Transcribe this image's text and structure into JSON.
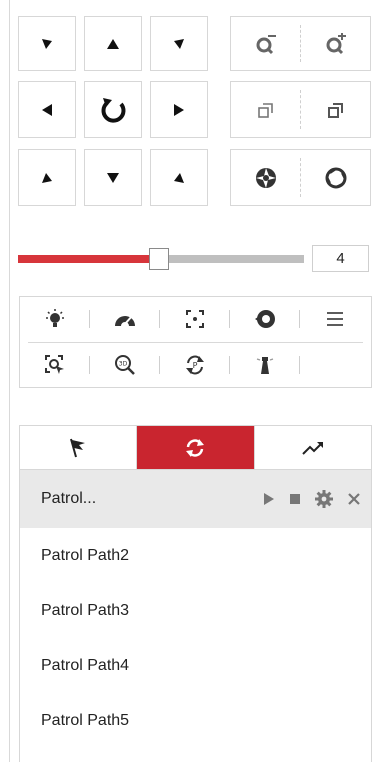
{
  "ptz": {
    "directions": [
      "up-left",
      "up",
      "up-right",
      "left",
      "auto-rotate",
      "right",
      "down-left",
      "down",
      "down-right"
    ],
    "zoom": [
      "zoom-out",
      "zoom-in"
    ],
    "focus": [
      "focus-near",
      "focus-far"
    ],
    "iris": [
      "iris-open",
      "iris-close"
    ]
  },
  "speed": {
    "value": "4",
    "level_fraction": 0.48,
    "colors": {
      "fill": "#d7353b",
      "rest": "#bfbfbf"
    }
  },
  "functions": {
    "row1": [
      "light-icon",
      "wiper-icon",
      "one-touch-focus-icon",
      "lens-init-icon",
      "menu-icon"
    ],
    "row2": [
      "manual-tracking-icon",
      "3d-zoom-icon",
      "park-action-icon",
      "manual-search-icon"
    ]
  },
  "tabs": {
    "items": [
      "preset-flag-icon",
      "patrol-icon",
      "pattern-icon"
    ],
    "active_index": 1,
    "accent": "#c9252f"
  },
  "patrol": {
    "selected": "Patrol...",
    "items": [
      "Patrol Path2",
      "Patrol Path3",
      "Patrol Path4",
      "Patrol Path5"
    ]
  }
}
